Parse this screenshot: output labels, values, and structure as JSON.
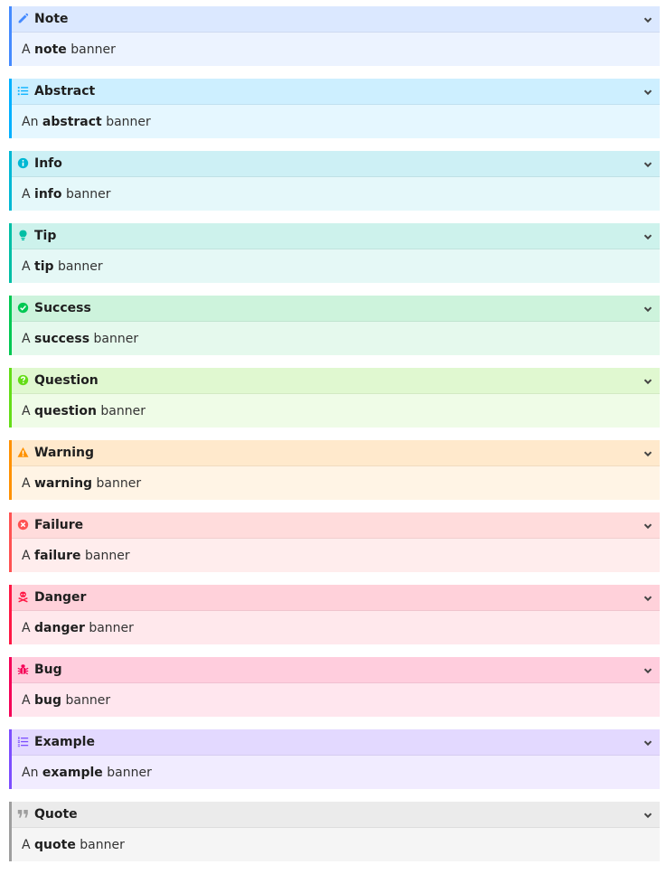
{
  "admonitions": [
    {
      "type": "note",
      "title": "Note",
      "prefix": "A",
      "keyword": "note",
      "suffix": "banner",
      "icon": "pencil-icon",
      "color": "#448aff"
    },
    {
      "type": "abstract",
      "title": "Abstract",
      "prefix": "An",
      "keyword": "abstract",
      "suffix": "banner",
      "icon": "list-icon",
      "color": "#00b0ff"
    },
    {
      "type": "info",
      "title": "Info",
      "prefix": "A",
      "keyword": "info",
      "suffix": "banner",
      "icon": "info-circle-icon",
      "color": "#00b8d4"
    },
    {
      "type": "tip",
      "title": "Tip",
      "prefix": "A",
      "keyword": "tip",
      "suffix": "banner",
      "icon": "lightbulb-icon",
      "color": "#00bfa5"
    },
    {
      "type": "success",
      "title": "Success",
      "prefix": "A",
      "keyword": "success",
      "suffix": "banner",
      "icon": "check-circle-icon",
      "color": "#00c853"
    },
    {
      "type": "question",
      "title": "Question",
      "prefix": "A",
      "keyword": "question",
      "suffix": "banner",
      "icon": "question-circle-icon",
      "color": "#64dd17"
    },
    {
      "type": "warning",
      "title": "Warning",
      "prefix": "A",
      "keyword": "warning",
      "suffix": "banner",
      "icon": "warning-triangle-icon",
      "color": "#ff9100"
    },
    {
      "type": "failure",
      "title": "Failure",
      "prefix": "A",
      "keyword": "failure",
      "suffix": "banner",
      "icon": "x-circle-icon",
      "color": "#ff5252"
    },
    {
      "type": "danger",
      "title": "Danger",
      "prefix": "A",
      "keyword": "danger",
      "suffix": "banner",
      "icon": "skull-crossbones-icon",
      "color": "#ff1744"
    },
    {
      "type": "bug",
      "title": "Bug",
      "prefix": "A",
      "keyword": "bug",
      "suffix": "banner",
      "icon": "bug-icon",
      "color": "#f50057"
    },
    {
      "type": "example",
      "title": "Example",
      "prefix": "An",
      "keyword": "example",
      "suffix": "banner",
      "icon": "numbered-list-icon",
      "color": "#7c4dff"
    },
    {
      "type": "quote",
      "title": "Quote",
      "prefix": "A",
      "keyword": "quote",
      "suffix": "banner",
      "icon": "quote-icon",
      "color": "#9e9e9e"
    }
  ]
}
